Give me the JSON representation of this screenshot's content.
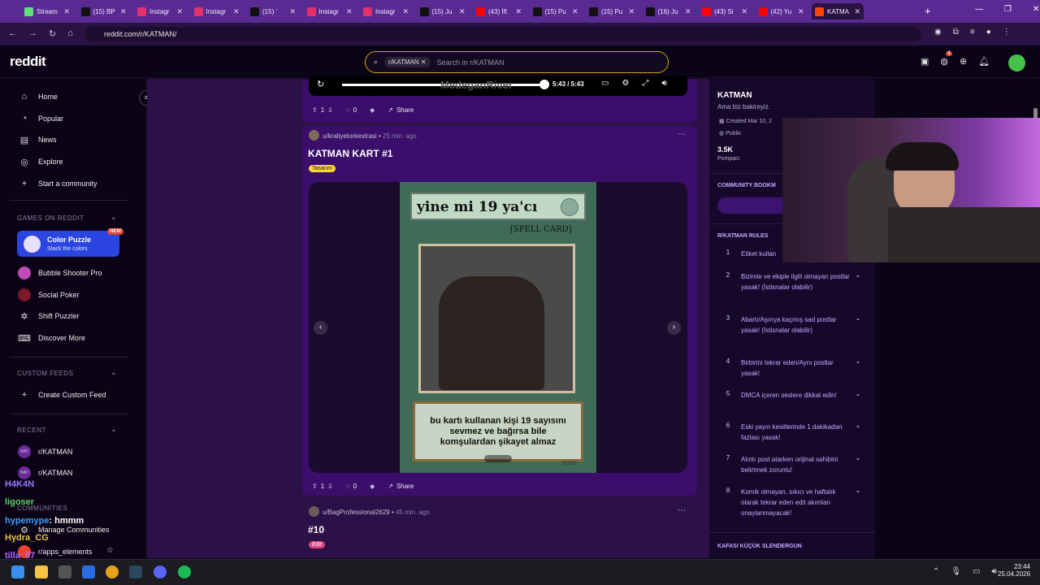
{
  "tabs": [
    {
      "label": "Stream",
      "fav": "#5ee07a"
    },
    {
      "label": "(15) BP",
      "fav": "#111"
    },
    {
      "label": "Instagr",
      "fav": "#e1306c"
    },
    {
      "label": "Instagr",
      "fav": "#e1306c"
    },
    {
      "label": "(15) '",
      "fav": "#111"
    },
    {
      "label": "Instagr",
      "fav": "#e1306c"
    },
    {
      "label": "Instagr",
      "fav": "#e1306c"
    },
    {
      "label": "(15) Ju",
      "fav": "#111"
    },
    {
      "label": "(43) İft",
      "fav": "#ff0000"
    },
    {
      "label": "(15) Pu",
      "fav": "#111"
    },
    {
      "label": "(15) Pu",
      "fav": "#111"
    },
    {
      "label": "(16) Ju",
      "fav": "#111"
    },
    {
      "label": "(43) Si",
      "fav": "#ff0000"
    },
    {
      "label": "(42) Yu",
      "fav": "#ff0000"
    },
    {
      "label": "KATMA",
      "fav": "#ff4500"
    }
  ],
  "url": "reddit.com/r/KATMAN/",
  "header": {
    "logo": "reddit",
    "chip": "r/KATMAN",
    "search_placeholder": "Search in r/KATMAN",
    "notif_count": "1"
  },
  "nav": {
    "home": "Home",
    "popular": "Popular",
    "news": "News",
    "explore": "Explore",
    "start": "Start a community"
  },
  "games": {
    "title": "GAMES ON REDDIT",
    "feature_title": "Color Puzzle",
    "feature_sub": "Stack the colors",
    "new": "NEW",
    "items": [
      "Bubble Shooter Pro",
      "Social Poker",
      "Shift Puzzler",
      "Discover More"
    ]
  },
  "custom": {
    "title": "CUSTOM FEEDS",
    "create": "Create Custom Feed"
  },
  "recent": {
    "title": "RECENT",
    "items": [
      "r/KATMAN",
      "r/KATMAN"
    ]
  },
  "communities": {
    "title": "COMMUNITIES",
    "manage": "Manage Communities",
    "item": "r/apps_elements"
  },
  "video": {
    "time": "5:43 / 5:43",
    "overlay": "MedeganRiver"
  },
  "post1": {
    "votes": "1",
    "comments": "0",
    "share": "Share"
  },
  "post2": {
    "author": "u/kraliyetorkestrasi",
    "age": "25 min. ago",
    "title": "KATMAN KART #1",
    "flair": "Tasarım",
    "votes": "1",
    "comments": "0",
    "share": "Share"
  },
  "card": {
    "title": "yine mi 19 ya'cı",
    "type": "[SPELL CARD]",
    "text": "bu kartı kullanan kişi 19 sayısını sevmez ve bağırsa bile komşulardan şikayet almaz",
    "copyright": "©2009"
  },
  "post3": {
    "author": "u/BagProfessional2629",
    "age": "45 min. ago",
    "title": "#10",
    "flair": "Edit"
  },
  "sidebar": {
    "name": "KATMAN",
    "desc": "Ama biz bakireyiz.",
    "created": "Created Mar 10, 2",
    "public": "Public",
    "members": "3.5K",
    "members_label": "Pompacı",
    "bookmarks": "COMMUNITY BOOKM",
    "rules_title": "R/KATMAN RULES",
    "rules": [
      "Etiket kullan",
      "Bizimle ve ekiple ilgili olmayan postlar yasak! (İstisnalar olabilir)",
      "Abartı/Aşırıya kaçmış sad postlar yasak! (İstisnalar olabilir)",
      "Birbirini tekrar eden/Aynı postlar yasak!",
      "DMCA içeren seslere dikkat edin!",
      "Eski yayın kesitlerinde 1 dakikadan fazlası yasak!",
      "Alıntı post atarken orijinal sahibini belirtmek zorunlu!",
      "Komik olmayan, sıkıcı ve haftalık olarak tekrar eden edit akımları onaylanmayacak!"
    ],
    "next_section": "KAFASI KÜÇÜK SLENDERGUN"
  },
  "chat": [
    {
      "user": "H4K4N",
      "color": "#9b7bff",
      "msg": ""
    },
    {
      "user": "ligoser",
      "color": "#5fd35f",
      "msg": ""
    },
    {
      "user": "hypemype",
      "color": "#3aa0ff",
      "msg": ": hmmm"
    },
    {
      "user": "Hydra_CG",
      "color": "#e8c43a",
      "msg": ""
    },
    {
      "user": "tilla_07",
      "color": "#b06bff",
      "msg": ""
    }
  ],
  "taskbar": {
    "time": "23:44",
    "date": "25.04.2026"
  }
}
